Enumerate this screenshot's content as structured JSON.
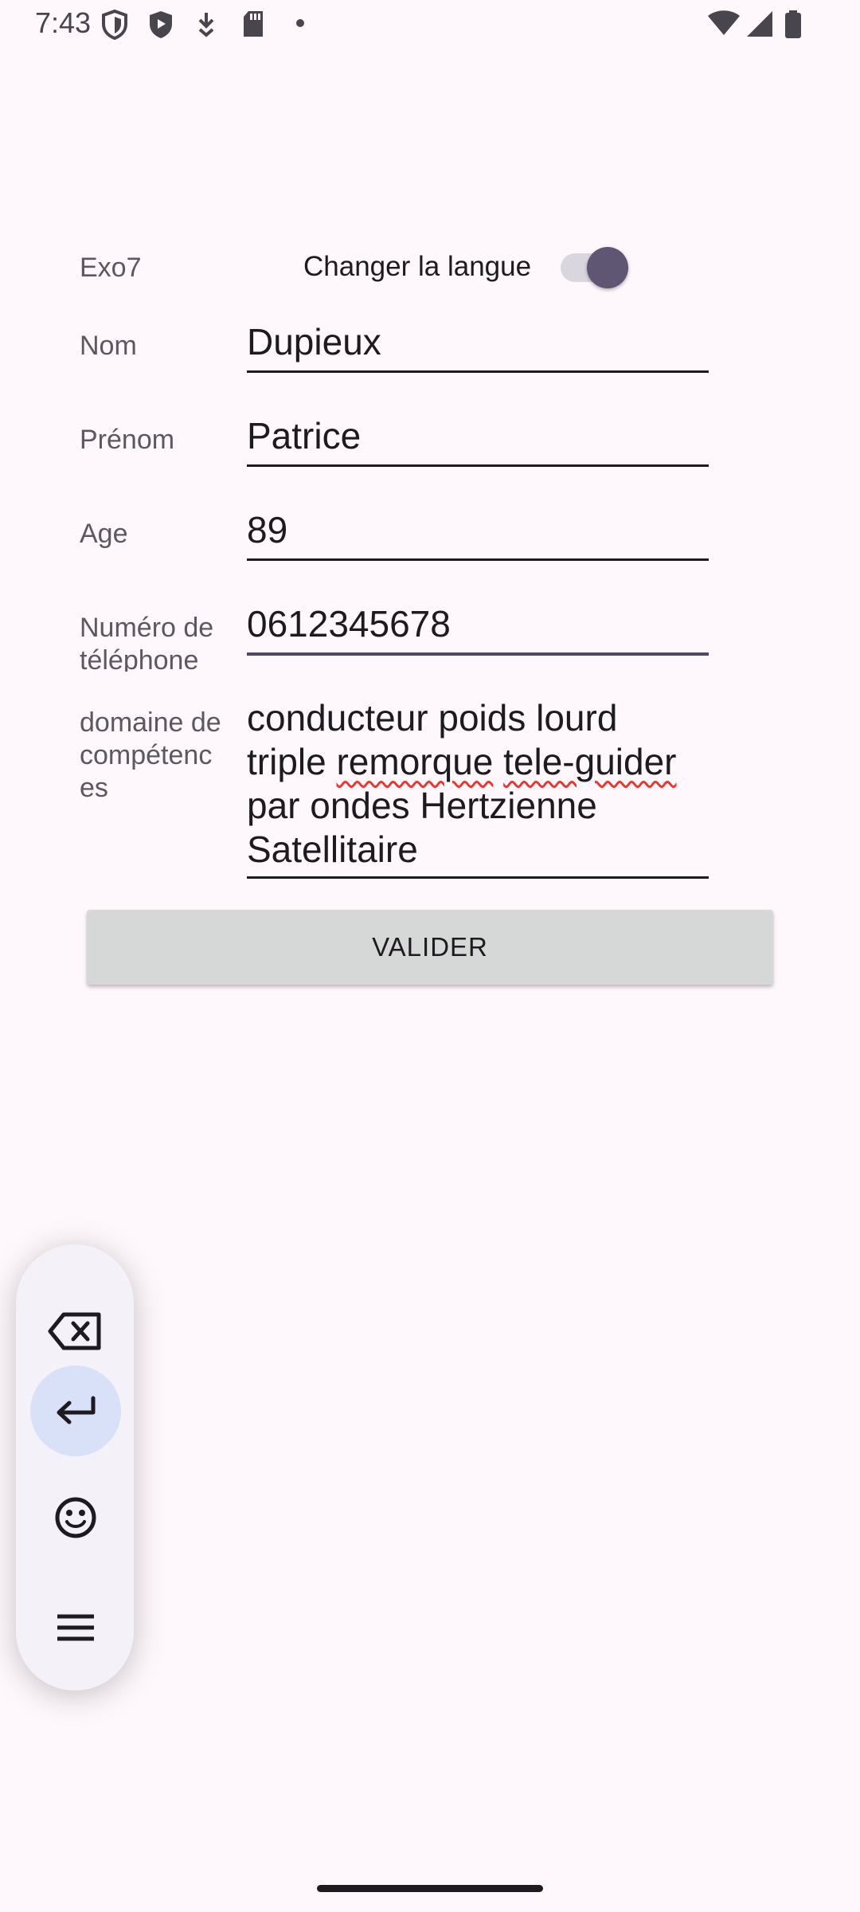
{
  "status_bar": {
    "time": "7:43"
  },
  "form": {
    "app_title": "Exo7",
    "language_toggle": {
      "label": "Changer la langue",
      "state": "on"
    },
    "fields": [
      {
        "label": "Nom",
        "value": "Dupieux"
      },
      {
        "label": "Prénom",
        "value": "Patrice"
      },
      {
        "label": "Age",
        "value": "89"
      },
      {
        "label": "Numéro de téléphone",
        "value": "0612345678"
      },
      {
        "label": "domaine de compétences",
        "value": "conducteur poids lourd triple remorque tele-guider par ondes Hertzienne Satellitaire"
      }
    ],
    "phone_label_lines": [
      "Numéro de",
      "téléphone"
    ],
    "domain_label_lines": [
      "domaine de",
      "compétenc",
      "es"
    ],
    "domain_value_lines": [
      "conducteur poids lourd",
      "par ondes Hertzienne",
      "Satellitaire"
    ],
    "domain_line2_parts": [
      "triple ",
      "remorque",
      " ",
      "tele-guider"
    ],
    "submit_label": "VALIDER"
  },
  "keyboard_panel": {
    "icons": [
      "backspace-icon",
      "enter-icon",
      "emoji-icon",
      "menu-icon"
    ],
    "selected": "enter-icon"
  },
  "colors": {
    "background": "#fef7fb",
    "accent": "#5e5673",
    "button": "#d6d7d7",
    "spellcheck": "#e53935"
  }
}
